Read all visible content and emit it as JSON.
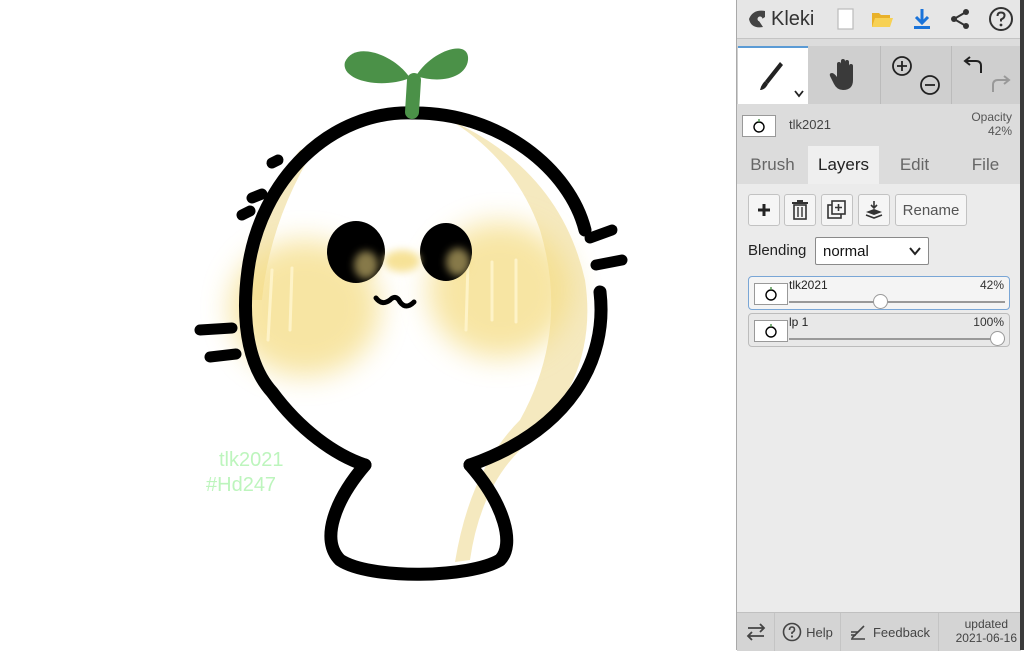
{
  "app": {
    "name": "Kleki"
  },
  "watermark": {
    "line1": "tlk2021",
    "line2": "#Hd247"
  },
  "active_layer": {
    "name": "tlk2021",
    "opacity_label": "Opacity",
    "opacity_value": "42%"
  },
  "tabs": [
    {
      "label": "Brush"
    },
    {
      "label": "Layers"
    },
    {
      "label": "Edit"
    },
    {
      "label": "File"
    }
  ],
  "active_tab": "Layers",
  "layers_panel": {
    "rename_label": "Rename",
    "blending_label": "Blending",
    "blending_value": "normal",
    "layers": [
      {
        "name": "tlk2021",
        "opacity_text": "42%",
        "opacity": 0.42,
        "selected": true
      },
      {
        "name": "lp 1",
        "opacity_text": "100%",
        "opacity": 1.0,
        "selected": false
      }
    ]
  },
  "footer": {
    "help_label": "Help",
    "feedback_label": "Feedback",
    "updated_label": "updated",
    "updated_date": "2021-06-16"
  },
  "icons": {
    "topbar": [
      "kleki-logo-icon",
      "new-file-icon",
      "open-folder-icon",
      "download-icon",
      "share-icon",
      "help-icon"
    ],
    "tools": [
      "brush-icon",
      "hand-icon",
      "zoom-in-icon",
      "zoom-out-icon",
      "undo-icon",
      "redo-icon"
    ],
    "layer_actions": [
      "add-layer-icon",
      "delete-layer-icon",
      "duplicate-layer-icon",
      "merge-down-icon"
    ],
    "footer": [
      "swap-icon",
      "help-circle-icon",
      "feedback-icon"
    ]
  },
  "colors": {
    "accent": "#5b9bd5",
    "panel_bg": "#dcdcdc",
    "watermark": "#bdf5bd",
    "sprout": "#4b9148"
  }
}
